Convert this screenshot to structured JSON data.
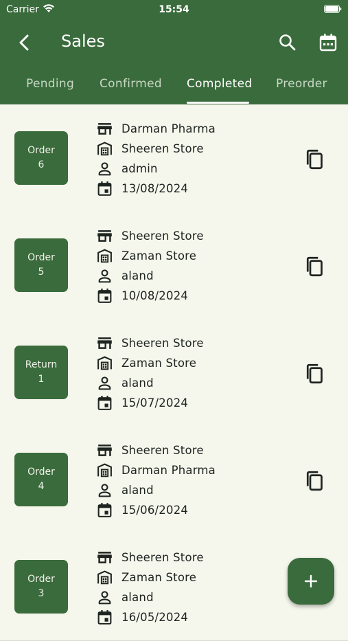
{
  "status_bar": {
    "carrier": "Carrier",
    "time": "15:54"
  },
  "toolbar": {
    "title": "Sales"
  },
  "tabs": [
    {
      "label": "Pending"
    },
    {
      "label": "Confirmed"
    },
    {
      "label": "Completed",
      "active": true
    },
    {
      "label": "Preorder"
    }
  ],
  "orders": [
    {
      "badge_type": "Order",
      "badge_number": "6",
      "from": "Darman Pharma",
      "to": "Sheeren Store",
      "user": "admin",
      "date": "13/08/2024"
    },
    {
      "badge_type": "Order",
      "badge_number": "5",
      "from": "Sheeren Store",
      "to": "Zaman Store",
      "user": "aland",
      "date": "10/08/2024"
    },
    {
      "badge_type": "Return",
      "badge_number": "1",
      "from": "Sheeren Store",
      "to": "Zaman Store",
      "user": "aland",
      "date": "15/07/2024"
    },
    {
      "badge_type": "Order",
      "badge_number": "4",
      "from": "Sheeren Store",
      "to": "Darman Pharma",
      "user": "aland",
      "date": "15/06/2024"
    },
    {
      "badge_type": "Order",
      "badge_number": "3",
      "from": "Sheeren Store",
      "to": "Zaman Store",
      "user": "aland",
      "date": "16/05/2024"
    }
  ],
  "colors": {
    "primary": "#3a6b3c",
    "background": "#f5f6ec",
    "text": "#1e2420"
  },
  "icons": {
    "back": "chevron-left-icon",
    "search": "search-icon",
    "calendar": "calendar-icon",
    "from": "storefront-icon",
    "to": "warehouse-icon",
    "user": "person-icon",
    "date": "event-icon",
    "copy": "copy-icon",
    "add": "plus-icon"
  }
}
